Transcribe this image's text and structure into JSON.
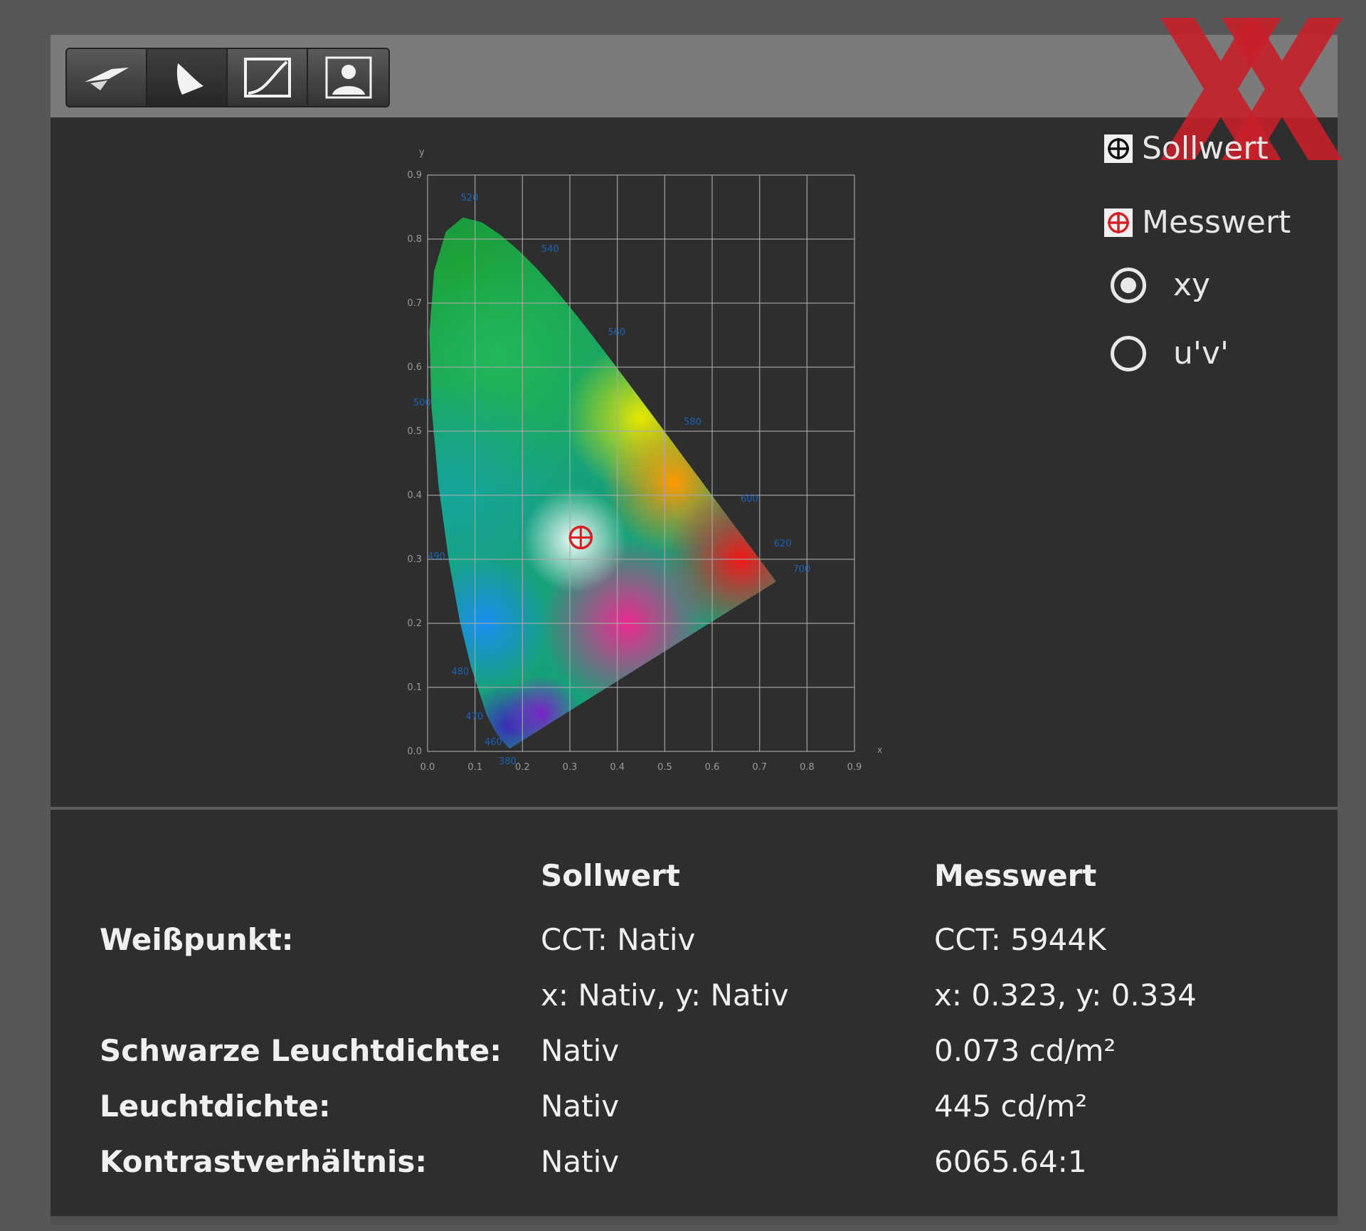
{
  "toolbar": {
    "tools": [
      {
        "name": "display-tool",
        "active": false
      },
      {
        "name": "gamut-tool",
        "active": true
      },
      {
        "name": "curve-tool",
        "active": false
      },
      {
        "name": "person-tool",
        "active": false
      }
    ]
  },
  "chart_data": {
    "type": "scatter",
    "title": "",
    "xlabel": "x",
    "ylabel": "y",
    "xlim": [
      0.0,
      0.9
    ],
    "ylim": [
      0.0,
      0.9
    ],
    "xticks": [
      "0.0",
      "0.1",
      "0.2",
      "0.3",
      "0.4",
      "0.5",
      "0.6",
      "0.7",
      "0.8",
      "0.9"
    ],
    "yticks": [
      "0.0",
      "0.1",
      "0.2",
      "0.3",
      "0.4",
      "0.5",
      "0.6",
      "0.7",
      "0.8",
      "0.9"
    ],
    "grid": true,
    "wavelength_labels": [
      "520",
      "540",
      "560",
      "580",
      "600",
      "620",
      "700",
      "500",
      "490",
      "480",
      "470",
      "460",
      "380"
    ],
    "measured_point": {
      "x": 0.323,
      "y": 0.334
    },
    "legend_position": "top-right"
  },
  "legend": {
    "target_label": "Sollwert",
    "measured_label": "Messwert",
    "option_xy": "xy",
    "option_uv": "u'v'",
    "selected": "xy"
  },
  "table": {
    "col_target": "Sollwert",
    "col_measured": "Messwert",
    "rows": [
      {
        "label": "Weißpunkt:",
        "target": "CCT: Nativ",
        "measured": "CCT: 5944K"
      },
      {
        "label": "",
        "target": "x: Nativ, y: Nativ",
        "measured": "x: 0.323, y: 0.334"
      },
      {
        "label": "Schwarze Leuchtdichte:",
        "target": "Nativ",
        "measured": "0.073 cd/m²"
      },
      {
        "label": "Leuchtdichte:",
        "target": "Nativ",
        "measured": "445 cd/m²"
      },
      {
        "label": "Kontrastverhältnis:",
        "target": "Nativ",
        "measured": "6065.64:1"
      }
    ]
  },
  "colors": {
    "panel": "#2e2e2e",
    "toolbar": "#7b7b7b",
    "logo_red": "#c8202a",
    "measured_marker": "#d81f26",
    "wavelength_text": "#1c63b5"
  }
}
